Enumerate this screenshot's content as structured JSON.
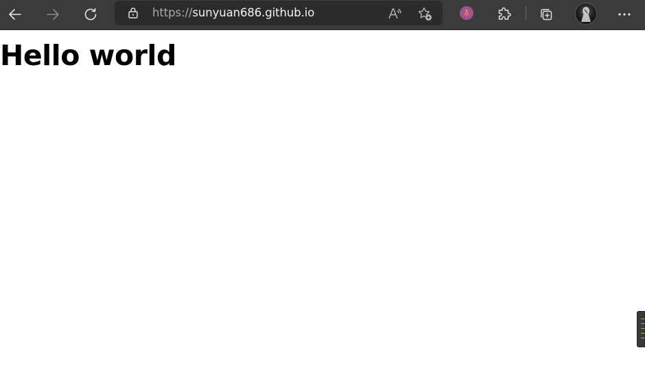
{
  "browser": {
    "address_bar": {
      "scheme": "https://",
      "host": "sunyuan686.github.io"
    },
    "toolbar_icons": [
      "back-icon",
      "forward-icon",
      "refresh-icon",
      "lock-icon",
      "read-aloud-icon",
      "add-favorite-icon",
      "extension-icon",
      "extensions-puzzle-icon",
      "collections-icon",
      "profile-avatar",
      "more-options-icon"
    ],
    "colors": {
      "toolbar_background": "#3b3b3b",
      "address_bar_background": "#2b2b2b",
      "icon_color": "#e6e6e6",
      "disabled_icon_color": "#8a8a8a",
      "extension_accent": "#a2548f"
    }
  },
  "page": {
    "heading": "Hello world",
    "background": "#ffffff"
  }
}
